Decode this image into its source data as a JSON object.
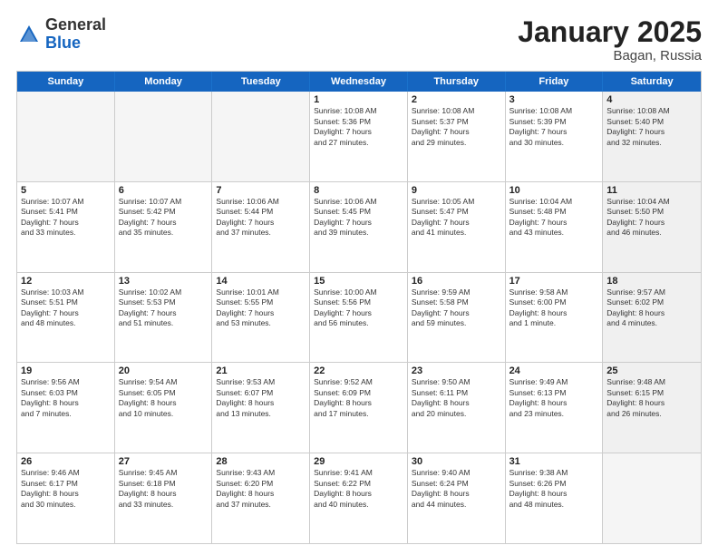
{
  "header": {
    "logo_general": "General",
    "logo_blue": "Blue",
    "title": "January 2025",
    "location": "Bagan, Russia"
  },
  "weekdays": [
    "Sunday",
    "Monday",
    "Tuesday",
    "Wednesday",
    "Thursday",
    "Friday",
    "Saturday"
  ],
  "rows": [
    [
      {
        "day": "",
        "info": "",
        "empty": true
      },
      {
        "day": "",
        "info": "",
        "empty": true
      },
      {
        "day": "",
        "info": "",
        "empty": true
      },
      {
        "day": "1",
        "info": "Sunrise: 10:08 AM\nSunset: 5:36 PM\nDaylight: 7 hours\nand 27 minutes."
      },
      {
        "day": "2",
        "info": "Sunrise: 10:08 AM\nSunset: 5:37 PM\nDaylight: 7 hours\nand 29 minutes."
      },
      {
        "day": "3",
        "info": "Sunrise: 10:08 AM\nSunset: 5:39 PM\nDaylight: 7 hours\nand 30 minutes."
      },
      {
        "day": "4",
        "info": "Sunrise: 10:08 AM\nSunset: 5:40 PM\nDaylight: 7 hours\nand 32 minutes.",
        "shaded": true
      }
    ],
    [
      {
        "day": "5",
        "info": "Sunrise: 10:07 AM\nSunset: 5:41 PM\nDaylight: 7 hours\nand 33 minutes."
      },
      {
        "day": "6",
        "info": "Sunrise: 10:07 AM\nSunset: 5:42 PM\nDaylight: 7 hours\nand 35 minutes."
      },
      {
        "day": "7",
        "info": "Sunrise: 10:06 AM\nSunset: 5:44 PM\nDaylight: 7 hours\nand 37 minutes."
      },
      {
        "day": "8",
        "info": "Sunrise: 10:06 AM\nSunset: 5:45 PM\nDaylight: 7 hours\nand 39 minutes."
      },
      {
        "day": "9",
        "info": "Sunrise: 10:05 AM\nSunset: 5:47 PM\nDaylight: 7 hours\nand 41 minutes."
      },
      {
        "day": "10",
        "info": "Sunrise: 10:04 AM\nSunset: 5:48 PM\nDaylight: 7 hours\nand 43 minutes."
      },
      {
        "day": "11",
        "info": "Sunrise: 10:04 AM\nSunset: 5:50 PM\nDaylight: 7 hours\nand 46 minutes.",
        "shaded": true
      }
    ],
    [
      {
        "day": "12",
        "info": "Sunrise: 10:03 AM\nSunset: 5:51 PM\nDaylight: 7 hours\nand 48 minutes."
      },
      {
        "day": "13",
        "info": "Sunrise: 10:02 AM\nSunset: 5:53 PM\nDaylight: 7 hours\nand 51 minutes."
      },
      {
        "day": "14",
        "info": "Sunrise: 10:01 AM\nSunset: 5:55 PM\nDaylight: 7 hours\nand 53 minutes."
      },
      {
        "day": "15",
        "info": "Sunrise: 10:00 AM\nSunset: 5:56 PM\nDaylight: 7 hours\nand 56 minutes."
      },
      {
        "day": "16",
        "info": "Sunrise: 9:59 AM\nSunset: 5:58 PM\nDaylight: 7 hours\nand 59 minutes."
      },
      {
        "day": "17",
        "info": "Sunrise: 9:58 AM\nSunset: 6:00 PM\nDaylight: 8 hours\nand 1 minute."
      },
      {
        "day": "18",
        "info": "Sunrise: 9:57 AM\nSunset: 6:02 PM\nDaylight: 8 hours\nand 4 minutes.",
        "shaded": true
      }
    ],
    [
      {
        "day": "19",
        "info": "Sunrise: 9:56 AM\nSunset: 6:03 PM\nDaylight: 8 hours\nand 7 minutes."
      },
      {
        "day": "20",
        "info": "Sunrise: 9:54 AM\nSunset: 6:05 PM\nDaylight: 8 hours\nand 10 minutes."
      },
      {
        "day": "21",
        "info": "Sunrise: 9:53 AM\nSunset: 6:07 PM\nDaylight: 8 hours\nand 13 minutes."
      },
      {
        "day": "22",
        "info": "Sunrise: 9:52 AM\nSunset: 6:09 PM\nDaylight: 8 hours\nand 17 minutes."
      },
      {
        "day": "23",
        "info": "Sunrise: 9:50 AM\nSunset: 6:11 PM\nDaylight: 8 hours\nand 20 minutes."
      },
      {
        "day": "24",
        "info": "Sunrise: 9:49 AM\nSunset: 6:13 PM\nDaylight: 8 hours\nand 23 minutes."
      },
      {
        "day": "25",
        "info": "Sunrise: 9:48 AM\nSunset: 6:15 PM\nDaylight: 8 hours\nand 26 minutes.",
        "shaded": true
      }
    ],
    [
      {
        "day": "26",
        "info": "Sunrise: 9:46 AM\nSunset: 6:17 PM\nDaylight: 8 hours\nand 30 minutes."
      },
      {
        "day": "27",
        "info": "Sunrise: 9:45 AM\nSunset: 6:18 PM\nDaylight: 8 hours\nand 33 minutes."
      },
      {
        "day": "28",
        "info": "Sunrise: 9:43 AM\nSunset: 6:20 PM\nDaylight: 8 hours\nand 37 minutes."
      },
      {
        "day": "29",
        "info": "Sunrise: 9:41 AM\nSunset: 6:22 PM\nDaylight: 8 hours\nand 40 minutes."
      },
      {
        "day": "30",
        "info": "Sunrise: 9:40 AM\nSunset: 6:24 PM\nDaylight: 8 hours\nand 44 minutes."
      },
      {
        "day": "31",
        "info": "Sunrise: 9:38 AM\nSunset: 6:26 PM\nDaylight: 8 hours\nand 48 minutes."
      },
      {
        "day": "",
        "info": "",
        "empty": true
      }
    ]
  ]
}
